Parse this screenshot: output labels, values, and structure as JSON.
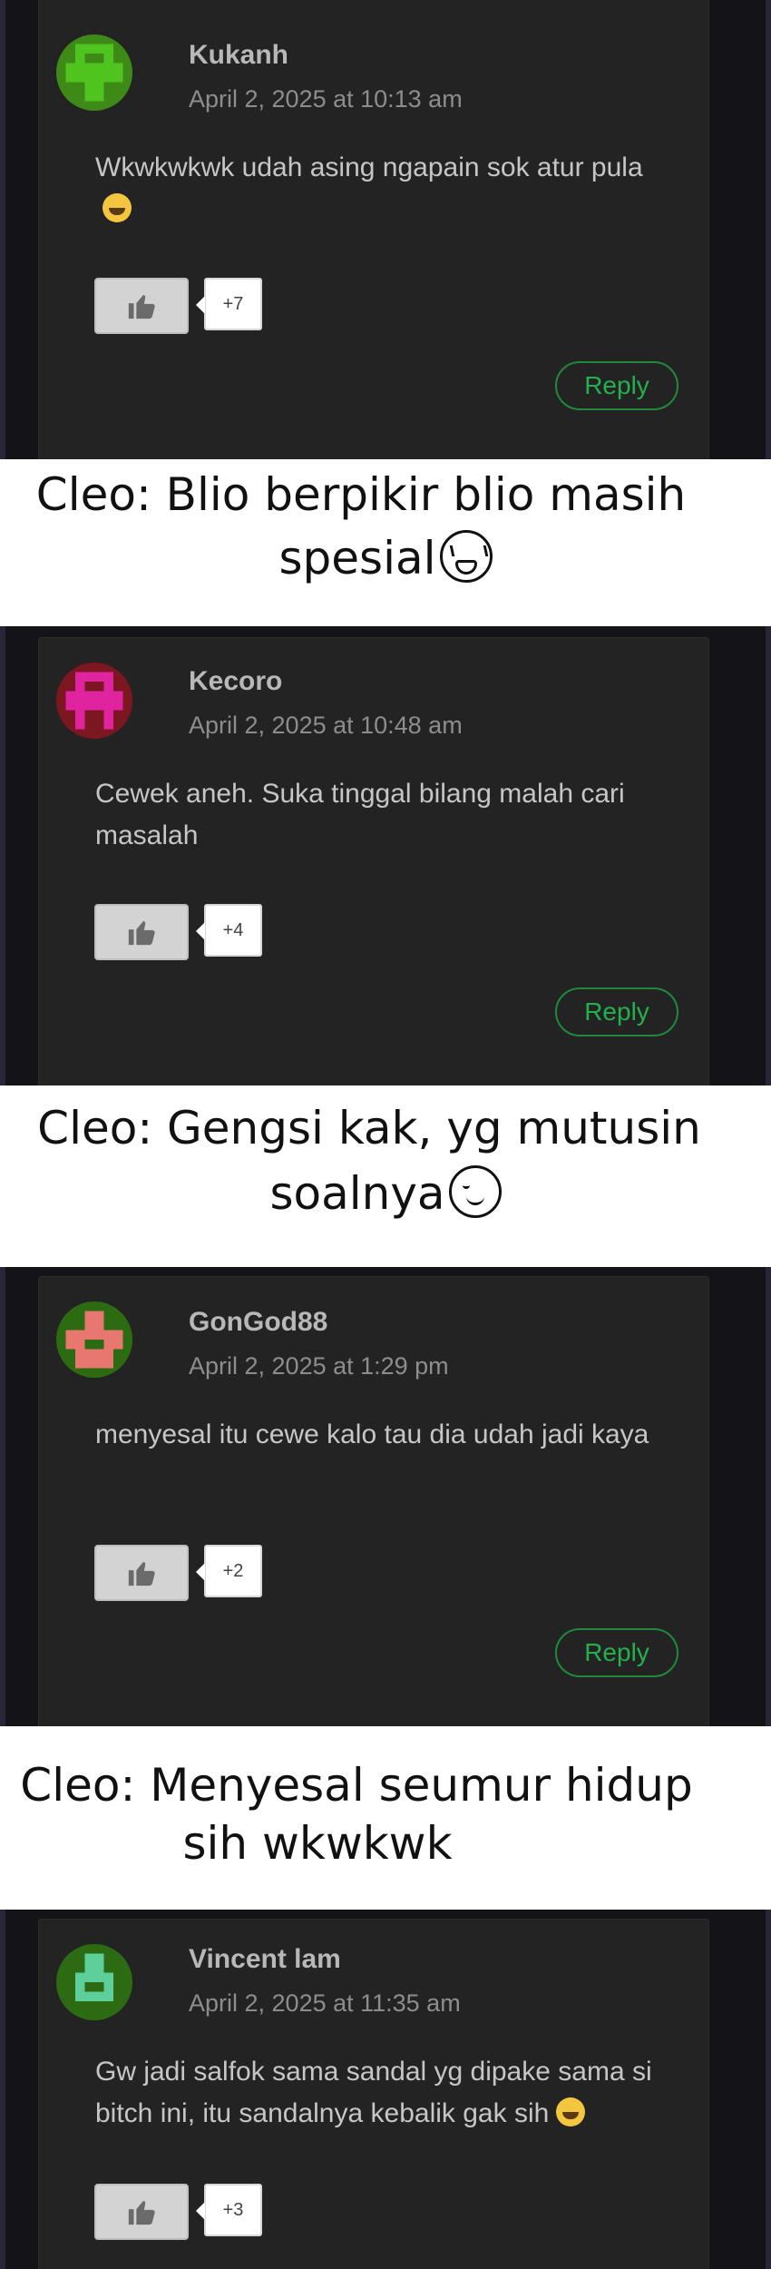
{
  "comments": [
    {
      "author": "Kukanh",
      "date": "April 2, 2025 at 10:13 am",
      "text": "Wkwkwkwk udah asing ngapain sok atur pula",
      "emoji": "grinning-sweat-emoji",
      "likes": "+7",
      "reply": "Reply",
      "avatar_color": "#4fc41e"
    },
    {
      "author": "Kecoro",
      "date": "April 2, 2025 at 10:48 am",
      "text": "Cewek aneh. Suka tinggal bilang malah cari masalah",
      "likes": "+4",
      "reply": "Reply",
      "avatar_color": "#e0239e"
    },
    {
      "author": "GonGod88",
      "date": "April 2, 2025 at 1:29 pm",
      "text": "menyesal itu cewe kalo tau dia udah jadi kaya",
      "likes": "+2",
      "reply": "Reply",
      "avatar_color": "#e8776f"
    },
    {
      "author": "Vincent lam",
      "date": "April 2, 2025 at 11:35 am",
      "text": "Gw jadi salfok sama sandal yg dipake sama si bitch ini, itu sandalnya kebalik gak sih",
      "emoji": "thinking-emoji",
      "likes": "+3",
      "reply": "Reply",
      "avatar_color": "#5ccf9a"
    }
  ],
  "captions": [
    {
      "line1": "Cleo: Blio berpikir blio masih",
      "line2": "spesial",
      "emoji": "squinting-face-emoji"
    },
    {
      "line1": "Cleo: Gengsi kak, yg mutusin",
      "line2": "soalnya",
      "emoji": "relieved-face-emoji"
    },
    {
      "line1": "Cleo: Menyesal seumur hidup",
      "line2": "sih wkwkwk"
    }
  ]
}
